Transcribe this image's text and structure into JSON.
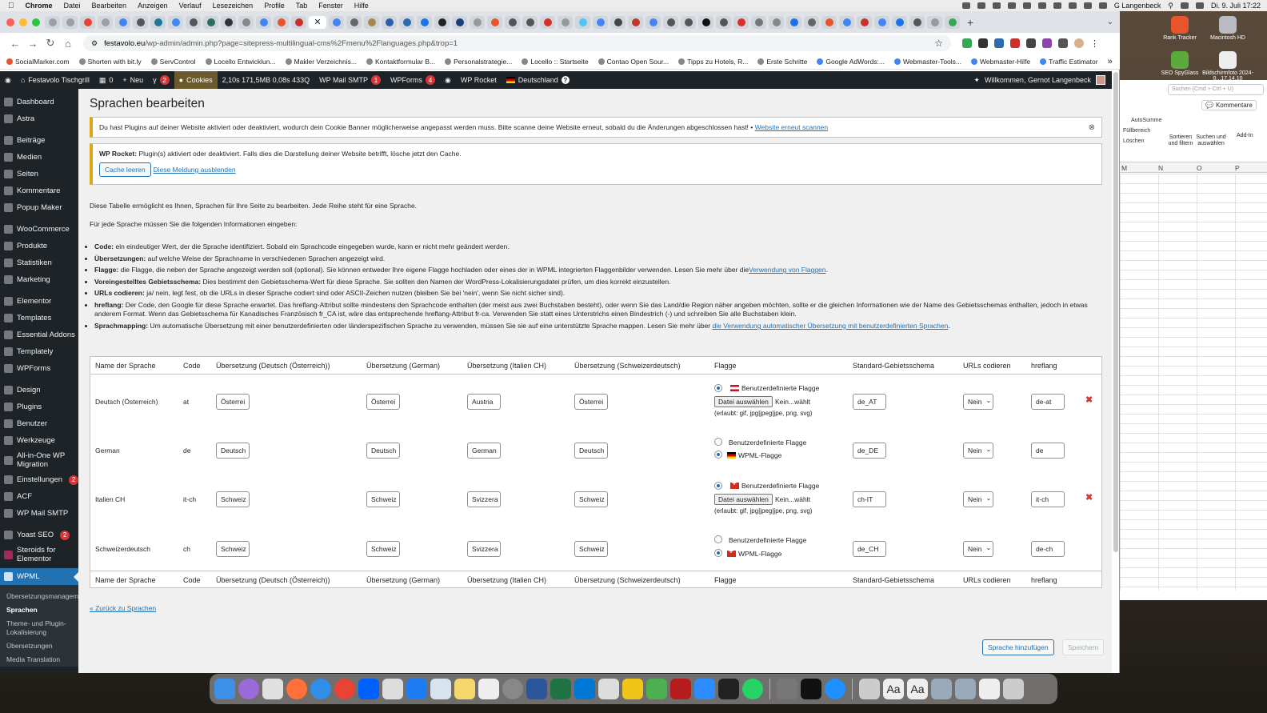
{
  "mac": {
    "menu": [
      "Chrome",
      "Datei",
      "Bearbeiten",
      "Anzeigen",
      "Verlauf",
      "Lesezeichen",
      "Profile",
      "Tab",
      "Fenster",
      "Hilfe"
    ],
    "user": "G Langenbeck",
    "datetime": "Di. 9. Juli 17:22"
  },
  "browser": {
    "url_domain": "festavolo.eu",
    "url_path": "/wp-admin/admin.php?page=sitepress-multilingual-cms%2Fmenu%2Flanguages.php&trop=1",
    "bookmarks": [
      "SocialMarker.com",
      "Shorten with bit.ly",
      "ServControl",
      "Locello Entwicklun...",
      "Makler Verzeichnis...",
      "Kontaktformular B...",
      "Personalstrategie...",
      "Locello :: Startseite",
      "Contao Open Sour...",
      "Tipps zu Hotels, R...",
      "Erste Schritte",
      "Google AdWords:...",
      "Webmaster-Tools...",
      "Webmaster-Hilfe",
      "Traffic Estimator"
    ],
    "more": "»"
  },
  "adminbar": {
    "site": "Festavolo Tischgrill",
    "comments": "0",
    "new": "Neu",
    "yoast_count": "2",
    "cookies": "Cookies",
    "perf": "2,10s  171,5MB  0,08s  433Q",
    "smtp": "WP Mail SMTP",
    "smtp_count": "1",
    "wpforms": "WPForms",
    "wpforms_count": "4",
    "rocket": "WP Rocket",
    "language": "Deutschland",
    "welcome": "Willkommen, Gernot Langenbeck"
  },
  "sidebar": {
    "items": [
      {
        "label": "Dashboard"
      },
      {
        "label": "Astra"
      },
      {
        "label": "Beiträge"
      },
      {
        "label": "Medien"
      },
      {
        "label": "Seiten"
      },
      {
        "label": "Kommentare"
      },
      {
        "label": "Popup Maker"
      },
      {
        "label": "WooCommerce"
      },
      {
        "label": "Produkte"
      },
      {
        "label": "Statistiken"
      },
      {
        "label": "Marketing"
      },
      {
        "label": "Elementor"
      },
      {
        "label": "Templates"
      },
      {
        "label": "Essential Addons"
      },
      {
        "label": "Templately"
      },
      {
        "label": "WPForms"
      },
      {
        "label": "Design"
      },
      {
        "label": "Plugins"
      },
      {
        "label": "Benutzer"
      },
      {
        "label": "Werkzeuge"
      },
      {
        "label": "All-in-One WP Migration"
      },
      {
        "label": "Einstellungen",
        "count": "2"
      },
      {
        "label": "ACF"
      },
      {
        "label": "WP Mail SMTP"
      },
      {
        "label": "Yoast SEO",
        "count": "2"
      },
      {
        "label": "Steroids for Elementor"
      },
      {
        "label": "WPML"
      }
    ],
    "submenu": [
      "Übersetzungsmanagement",
      "Sprachen",
      "Theme- und Plugin-Lokalisierung",
      "Übersetzungen",
      "Media Translation"
    ]
  },
  "page": {
    "title": "Sprachen bearbeiten",
    "cookie_notice": "Du hast Plugins auf deiner Website aktiviert oder deaktiviert, wodurch dein Cookie Banner möglicherweise angepasst werden muss. Bitte scanne deine Website erneut, sobald du die Änderungen abgeschlossen hast! •",
    "cookie_link": "Website erneut scannen",
    "rocket_label": "WP Rocket:",
    "rocket_text": "Plugin(s) aktiviert oder deaktiviert. Falls dies die Darstellung deiner Website betrifft, lösche jetzt den Cache.",
    "clear_cache": "Cache leeren",
    "dismiss": "Diese Meldung ausblenden",
    "intro1": "Diese Tabelle ermöglicht es Ihnen, Sprachen für Ihre Seite zu bearbeiten. Jede Reihe steht für eine Sprache.",
    "intro2": "Für jede Sprache müssen Sie die folgenden Informationen eingeben:",
    "bullets": [
      {
        "b": "Code:",
        "t": "ein eindeutiger Wert, der die Sprache identifiziert. Sobald ein Sprachcode eingegeben wurde, kann er nicht mehr geändert werden.",
        "link": ""
      },
      {
        "b": "Übersetzungen:",
        "t": "auf welche Weise der Sprachname in verschiedenen Sprachen angezeigt wird.",
        "link": ""
      },
      {
        "b": "Flagge:",
        "t": "die Flagge, die neben der Sprache angezeigt werden soll (optional). Sie können entweder Ihre eigene Flagge hochladen oder eines der in WPML integrierten Flaggenbilder verwenden. Lesen Sie mehr über die",
        "link": "Verwendung von Flaggen",
        "after": "."
      },
      {
        "b": "Voreingestelltes Gebietsschema:",
        "t": "Dies bestimmt den Gebietsschema-Wert für diese Sprache. Sie sollten den Namen der WordPress-Lokalisierungsdatei prüfen, um dies korrekt einzustellen.",
        "link": ""
      },
      {
        "b": "URLs codieren:",
        "t": "ja/ nein, legt fest, ob die URLs in dieser Sprache codiert sind oder ASCII-Zeichen nutzen (bleiben Sie bei 'nein', wenn Sie nicht sicher sind).",
        "link": ""
      },
      {
        "b": "hreflang:",
        "t": "Der Code, den Google für diese Sprache erwartet. Das hreflang-Attribut sollte mindestens den Sprachcode enthalten (der meist aus zwei Buchstaben besteht), oder wenn Sie das Land/die Region näher angeben möchten, sollte er die gleichen Informationen wie der Name des Gebietsschemas enthalten, jedoch in etwas anderem Format. Wenn das Gebietsschema für Kanadisches Französisch fr_CA ist, wäre das entsprechende hreflang-Attribut fr-ca. Verwenden Sie statt eines Unterstrichs einen Bindestrich (-) und schreiben Sie alle Buchstaben klein.",
        "link": ""
      },
      {
        "b": "Sprachmapping:",
        "t": "Um automatische Übersetzung mit einer benutzerdefinierten oder länderspezifischen Sprache zu verwenden, müssen Sie sie auf eine unterstützte Sprache mappen. Lesen Sie mehr über",
        "link": "die Verwendung automatischer Übersetzung mit benutzerdefinierten Sprachen",
        "after": "."
      }
    ],
    "back": "« Zurück zu Sprachen",
    "add_lang": "Sprache hinzufügen",
    "save": "Speichern"
  },
  "table": {
    "headers": [
      "Name der Sprache",
      "Code",
      "Übersetzung (Deutsch (Österreich))",
      "Übersetzung (German)",
      "Übersetzung (Italien CH)",
      "Übersetzung (Schweizerdeutsch)",
      "Flagge",
      "Standard-Gebietsschema",
      "URLs codieren",
      "hreflang"
    ],
    "rows": [
      {
        "name": "Deutsch (Österreich)",
        "code": "at",
        "t1": "Österrei",
        "t2": "Österrei",
        "t3": "Austria",
        "t4": "Österrei",
        "flag_mode": "custom",
        "flag": "at",
        "locale": "de_AT",
        "encode": "Nein",
        "hreflang": "de-at",
        "deletable": true
      },
      {
        "name": "German",
        "code": "de",
        "t1": "Deutsch",
        "t2": "Deutsch",
        "t3": "German",
        "t4": "Deutsch",
        "flag_mode": "wpml",
        "flag": "de",
        "locale": "de_DE",
        "encode": "Nein",
        "hreflang": "de",
        "deletable": false
      },
      {
        "name": "Italien CH",
        "code": "it-ch",
        "t1": "Schweiz",
        "t2": "Schweiz",
        "t3": "Svizzera",
        "t4": "Schweiz",
        "flag_mode": "custom",
        "flag": "ch",
        "locale": "ch-IT",
        "encode": "Nein",
        "hreflang": "it-ch",
        "deletable": true
      },
      {
        "name": "Schweizerdeutsch",
        "code": "ch",
        "t1": "Schweiz",
        "t2": "Schweiz",
        "t3": "Svizzera",
        "t4": "Schweiz",
        "flag_mode": "wpml",
        "flag": "ch",
        "locale": "de_CH",
        "encode": "Nein",
        "hreflang": "de-ch",
        "deletable": false
      }
    ],
    "custom_flag": "Benutzerdefinierte Flagge",
    "wpml_flag": "WPML-Flagge",
    "choose_file": "Datei auswählen",
    "no_file": "Kein...wählt",
    "allowed": "(erlaubt: gif, jpg|jpeg|jpe, png, svg)",
    "delete_icon": "✖"
  },
  "excel": {
    "ribbon": [
      "AutoSumme",
      "Füllbereich",
      "Löschen",
      "Sortieren und filtern",
      "Suchen und auswählen",
      "Add-In"
    ],
    "search": "Suchen (Cmd + Ctrl + U)",
    "comments": "Kommentare",
    "cols": [
      "M",
      "N",
      "O",
      "P"
    ]
  },
  "desktop": [
    "Rank Tracker",
    "Macintosh HD",
    "SEO SpyGlass",
    "Bildschirmfoto 2024-0...17.14.10"
  ]
}
